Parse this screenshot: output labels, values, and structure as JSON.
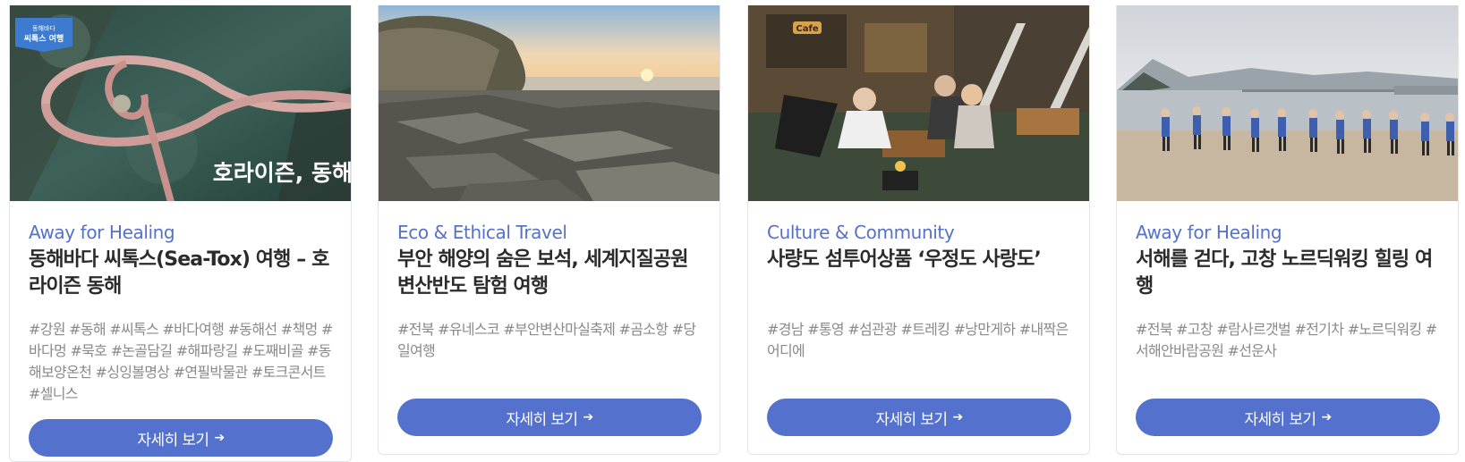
{
  "cards": [
    {
      "category": "Away for Healing",
      "title": "동해바다 씨톡스(Sea-Tox) 여행 – 호라이즌 동해",
      "tags": "#강원 #동해 #씨톡스 #바다여행 #동해선 #책멍 #바다멍 #묵호 #논골담길 #해파랑길 #도째비골 #동해보양온천 #싱잉볼명상 #연필박물관 #토크콘서트 #셀니스",
      "button": "자세히 보기",
      "image_badge_top": "동해바다",
      "image_badge_main": "씨톡스 여행",
      "image_caption": "호라이즌, 동해"
    },
    {
      "category": "Eco & Ethical Travel",
      "title": "부안 해양의 숨은 보석, 세계지질공원 변산반도 탐험 여행",
      "tags": "#전북 #유네스코 #부안변산마실축제 #곰소항 #당일여행",
      "button": "자세히 보기"
    },
    {
      "category": "Culture & Community",
      "title": "사량도 섬투어상품 ‘우정도 사랑도’",
      "tags": "#경남 #통영 #섬관광 #트레킹 #낭만게하 #내짝은어디에",
      "button": "자세히 보기",
      "image_sign": "Cafe"
    },
    {
      "category": "Away for Healing",
      "title": "서해를 걷다, 고창 노르딕워킹 힐링 여행",
      "tags": "#전북 #고창 #람사르갯벌 #전기차 #노르딕워킹 #서해안바람공원 #선운사",
      "button": "자세히 보기"
    }
  ],
  "icons": {
    "button_arrow": "arrow-right-icon"
  },
  "colors": {
    "accent": "#5471cd",
    "category": "#5671c9",
    "title": "#2b2b2b",
    "tags": "#8a8a8a"
  }
}
